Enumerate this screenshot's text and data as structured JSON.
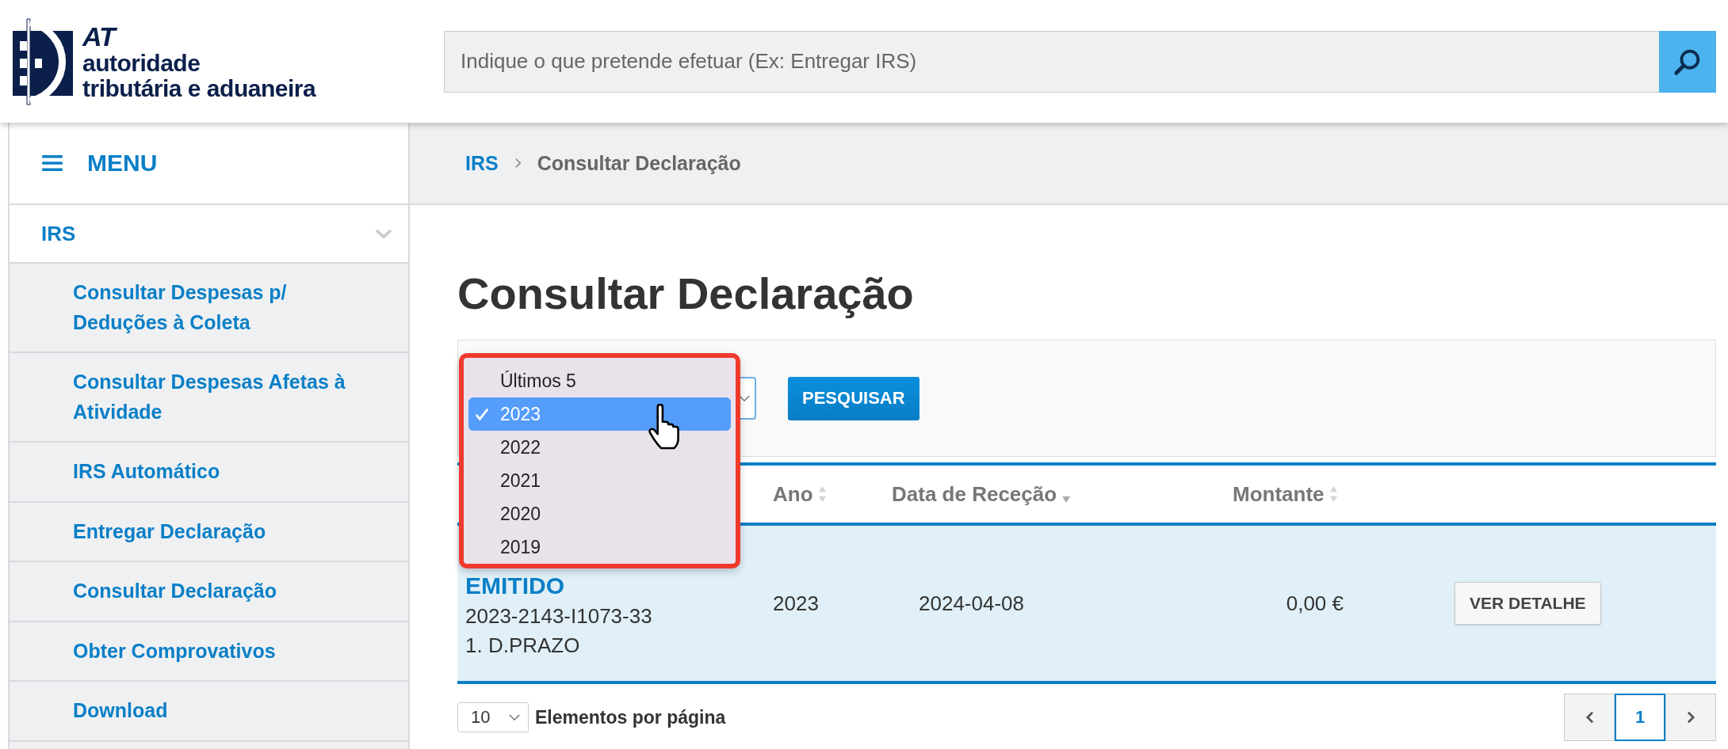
{
  "header": {
    "logo": {
      "short": "AT",
      "line1": "autoridade",
      "line2": "tributária e aduaneira"
    },
    "search": {
      "placeholder": "Indique o que pretende efetuar (Ex: Entregar IRS)"
    }
  },
  "sidebar": {
    "menu_label": "MENU",
    "section": {
      "label": "IRS",
      "expanded": true
    },
    "items": [
      {
        "label": "Consultar Despesas p/ Deduções à Coleta"
      },
      {
        "label": "Consultar Despesas Afetas à Atividade"
      },
      {
        "label": "IRS Automático"
      },
      {
        "label": "Entregar Declaração"
      },
      {
        "label": "Consultar Declaração"
      },
      {
        "label": "Obter Comprovativos"
      },
      {
        "label": "Download"
      }
    ]
  },
  "breadcrumb": [
    "IRS",
    "Consultar Declaração"
  ],
  "title": "Consultar Declaração",
  "filter": {
    "button": "PESQUISAR",
    "dropdown": {
      "open": true,
      "options": [
        {
          "label": "Últimos 5",
          "selected": false
        },
        {
          "label": "2023",
          "selected": true
        },
        {
          "label": "2022",
          "selected": false
        },
        {
          "label": "2021",
          "selected": false
        },
        {
          "label": "2020",
          "selected": false
        },
        {
          "label": "2019",
          "selected": false
        }
      ]
    }
  },
  "table": {
    "columns": [
      {
        "label": "Ano",
        "kind": "sortable"
      },
      {
        "label": "Data de Receção",
        "kind": "sorted-desc"
      },
      {
        "label": "Montante",
        "kind": "sortable"
      }
    ],
    "rows": [
      {
        "status": "EMITIDO",
        "reference": "2023-2143-I1073-33",
        "deadline": "1. D.PRAZO",
        "year": "2023",
        "date": "2024-04-08",
        "amount": "0,00 €",
        "action": "VER DETALHE"
      }
    ]
  },
  "pagination": {
    "page_size": "10",
    "page_size_label": "Elementos por página",
    "pages": [
      {
        "label": "1",
        "selected": true
      }
    ]
  }
}
